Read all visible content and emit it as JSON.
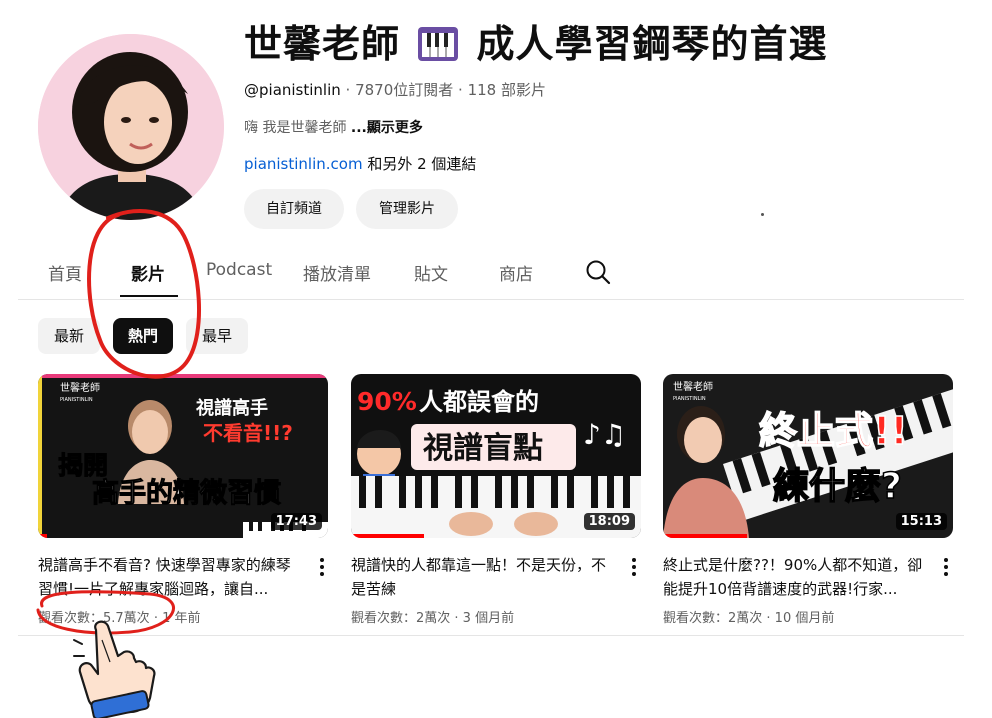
{
  "channel": {
    "name_part1": "世馨老師",
    "name_part2": "成人學習鋼琴的首選",
    "piano_emoji": "piano-emoji",
    "handle": "@pianistinlin",
    "stats": " · 7870位訂閱者 · 118 部影片",
    "description": "嗨  我是世馨老師 ",
    "show_more": "...顯示更多",
    "link_site": "pianistinlin.com",
    "link_others": " 和另外 2 個連結"
  },
  "buttons": {
    "customize": "自訂頻道",
    "manage": "管理影片"
  },
  "tabs": {
    "home": "首頁",
    "videos": "影片",
    "podcast": "Podcast",
    "playlists": "播放清單",
    "posts": "貼文",
    "store": "商店",
    "search_icon": "search-icon"
  },
  "chips": {
    "latest": "最新",
    "popular": "熱門",
    "oldest": "最早"
  },
  "videos": [
    {
      "title": "視譜高手不看音? 快速學習專家的練琴習慣!一片了解專家腦迴路，讓自...",
      "views": "觀看次數：5.7萬次",
      "age": " · 1 年前",
      "duration": "17:43",
      "progress": 0.03,
      "thumb": {
        "brand_name": "世馨老師",
        "brand_en": "PIANISTINLIN",
        "line1": "視譜高手",
        "line2": "不看音!!?",
        "line3": "揭開",
        "line4": "高手的精微習慣"
      }
    },
    {
      "title": "視譜快的人都靠這一點！不是天份，不是苦練",
      "views": "觀看次數：2萬次",
      "age": " · 3 個月前",
      "duration": "18:09",
      "progress": 0.25,
      "thumb": {
        "line1_pct": "90%",
        "line1_rest": "人都誤會的",
        "line2": "視譜盲點"
      }
    },
    {
      "title": "終止式是什麼??！90%人都不知道，卻能提升10倍背譜速度的武器!行家...",
      "views": "觀看次數：2萬次",
      "age": " · 10 個月前",
      "duration": "15:13",
      "progress": 0.29,
      "thumb": {
        "brand_name": "世馨老師",
        "brand_en": "PIANISTINLIN",
        "line1": "終止式!!",
        "line2": "練什麼?"
      }
    }
  ],
  "colors": {
    "accent_red": "#ff0000",
    "link_blue": "#065fd4",
    "annotation_red": "#e0201b",
    "avatar_bg": "#f7d2df"
  }
}
